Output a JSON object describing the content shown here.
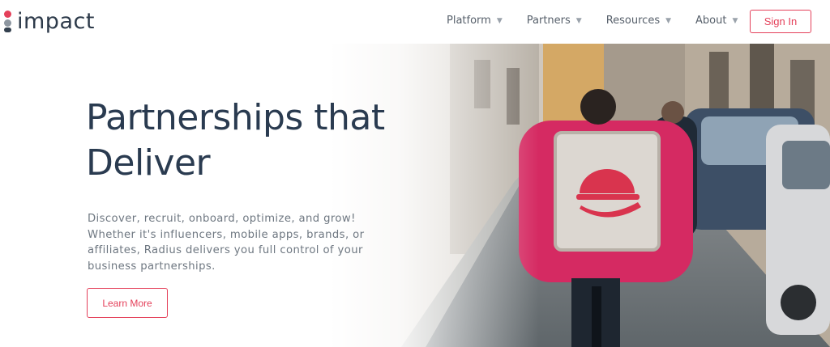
{
  "brand": {
    "logo_text": "impact",
    "accent_color": "#e4405a"
  },
  "nav": {
    "items": [
      {
        "label": "Platform",
        "icon": "caret-down-icon"
      },
      {
        "label": "Partners",
        "icon": "caret-down-icon"
      },
      {
        "label": "Resources",
        "icon": "caret-down-icon"
      },
      {
        "label": "About",
        "icon": "caret-down-icon"
      }
    ],
    "caret": "▼",
    "signin_label": "Sign In"
  },
  "hero": {
    "headline_line1": "Partnerships that",
    "headline_line2": "Deliver",
    "description": "Discover, recruit, onboard, optimize, and grow! Whether it's influencers, mobile apps, brands, or affiliates, Radius delivers you full control of your business partnerships.",
    "cta_label": "Learn More"
  }
}
